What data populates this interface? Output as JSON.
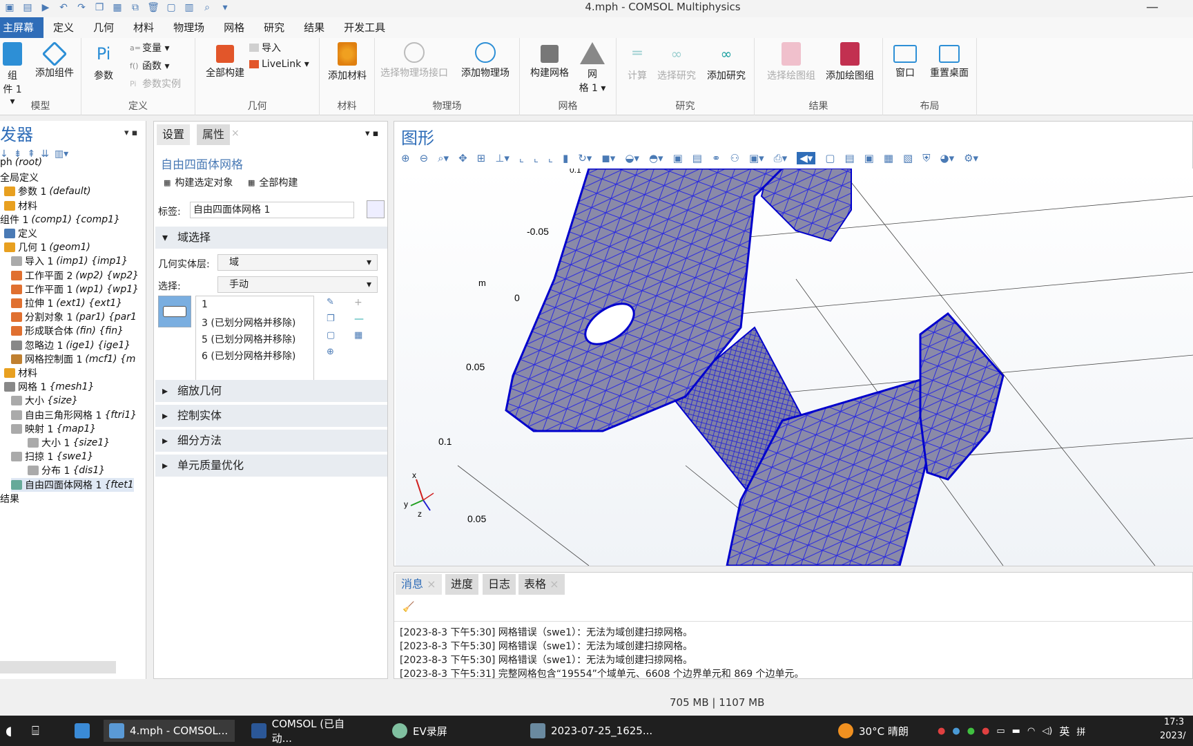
{
  "window": {
    "title": "4.mph - COMSOL Multiphysics",
    "minimize": "—"
  },
  "ribbon_tabs": [
    "主屏幕",
    "定义",
    "几何",
    "材料",
    "物理场",
    "网格",
    "研究",
    "结果",
    "开发工具"
  ],
  "ribbon": {
    "model": {
      "group": "模型",
      "component": "组\n件 1 ▾",
      "add_component": "添加组件"
    },
    "definitions": {
      "group": "定义",
      "parameters": "参数",
      "variables": "变量 ▾",
      "functions": "函数 ▾",
      "param_case": "参数实例"
    },
    "geometry": {
      "group": "几何",
      "build_all": "全部构建",
      "import": "导入",
      "livelink": "LiveLink ▾"
    },
    "materials": {
      "group": "材料",
      "add_material": "添加材料"
    },
    "physics": {
      "group": "物理场",
      "select_interface": "选择物理场接口",
      "add_physics": "添加物理场"
    },
    "mesh": {
      "group": "网格",
      "build_mesh": "构建网格",
      "mesh1": "网\n格 1 ▾"
    },
    "study": {
      "group": "研究",
      "compute": "计算",
      "select_study": "选择研究",
      "add_study": "添加研究"
    },
    "results": {
      "group": "结果",
      "select_plot": "选择绘图组",
      "add_plot": "添加绘图组"
    },
    "layout": {
      "group": "布局",
      "windows": "窗口",
      "reset_desktop": "重置桌面"
    }
  },
  "tree": {
    "title": "发器",
    "nodes": [
      {
        "text": "ph",
        "tag": "(root)"
      },
      {
        "text": "全局定义",
        "tag": ""
      },
      {
        "text": "参数 1",
        "tag": "(default)"
      },
      {
        "text": "材料",
        "tag": ""
      },
      {
        "text": "组件 1",
        "tag": "(comp1) {comp1}"
      },
      {
        "text": "定义",
        "tag": ""
      },
      {
        "text": "几何 1",
        "tag": "(geom1)"
      },
      {
        "text": "导入 1",
        "tag": "(imp1) {imp1}"
      },
      {
        "text": "工作平面 2",
        "tag": "(wp2) {wp2}"
      },
      {
        "text": "工作平面 1",
        "tag": "(wp1) {wp1}"
      },
      {
        "text": "拉伸 1",
        "tag": "(ext1) {ext1}"
      },
      {
        "text": "分割对象 1",
        "tag": "(par1) {par1"
      },
      {
        "text": "形成联合体",
        "tag": "(fin) {fin}"
      },
      {
        "text": "忽略边 1",
        "tag": "(ige1) {ige1}"
      },
      {
        "text": "网格控制面 1",
        "tag": "(mcf1) {m"
      },
      {
        "text": "材料",
        "tag": ""
      },
      {
        "text": "网格 1",
        "tag": "{mesh1}"
      },
      {
        "text": "大小",
        "tag": "{size}"
      },
      {
        "text": "自由三角形网格 1",
        "tag": "{ftri1}"
      },
      {
        "text": "映射 1",
        "tag": "{map1}"
      },
      {
        "text": "大小 1",
        "tag": "{size1}"
      },
      {
        "text": "扫掠 1",
        "tag": "{swe1}"
      },
      {
        "text": "分布 1",
        "tag": "{dis1}"
      },
      {
        "text": "自由四面体网格 1",
        "tag": "{ftet1"
      },
      {
        "text": "结果",
        "tag": ""
      }
    ]
  },
  "settings": {
    "tab_settings": "设置",
    "tab_properties": "属性",
    "title": "自由四面体网格",
    "build_selected": "构建选定对象",
    "build_all": "全部构建",
    "label_caption": "标签:",
    "label_value": "自由四面体网格 1",
    "domain_selection": "域选择",
    "geom_level_caption": "几何实体层:",
    "geom_level_value": "域",
    "selection_caption": "选择:",
    "selection_value": "手动",
    "domains": [
      "1",
      "3 (已划分网格并移除)",
      "5 (已划分网格并移除)",
      "6 (已划分网格并移除)"
    ],
    "sections": [
      "缩放几何",
      "控制实体",
      "细分方法",
      "单元质量优化"
    ]
  },
  "graphics": {
    "title": "图形",
    "axis_labels": [
      "0.1",
      "-0.05",
      "m",
      "0",
      "0.05",
      "0.1",
      "0.05"
    ],
    "triad": [
      "x",
      "y",
      "z"
    ]
  },
  "messages": {
    "tabs": [
      "消息",
      "进度",
      "日志",
      "表格"
    ],
    "lines": [
      "[2023-8-3 下午5:30] 网格错误（swe1）：无法为域创建扫掠网格。",
      "[2023-8-3 下午5:30] 网格错误（swe1）：无法为域创建扫掠网格。",
      "[2023-8-3 下午5:30] 网格错误（swe1）：无法为域创建扫掠网格。",
      "[2023-8-3 下午5:31] 完整网格包含“19554”个域单元、6608 个边界单元和 869 个边单元。"
    ]
  },
  "status": {
    "memory": "705 MB | 1107 MB"
  },
  "taskbar": {
    "apps": [
      "4.mph - COMSOL...",
      "COMSOL (已自动...",
      "EV录屏",
      "2023-07-25_1625..."
    ],
    "weather": "30°C  晴朗",
    "ime": "英",
    "time": "17:3",
    "date": "2023/"
  },
  "colors": {
    "accent": "#2f6db8",
    "mesh": "#3a3adc"
  }
}
